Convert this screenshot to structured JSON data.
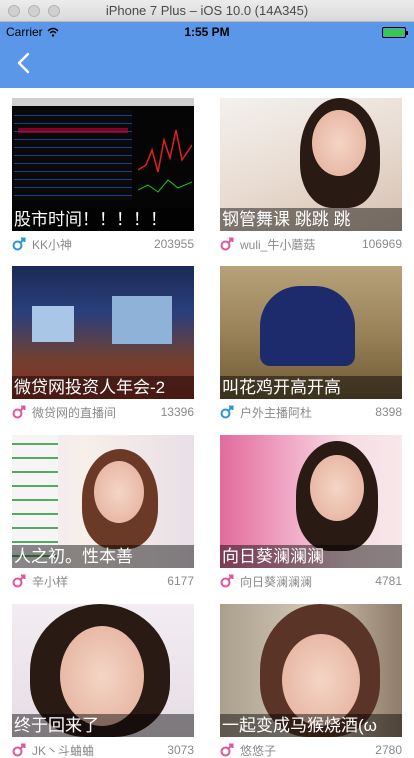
{
  "simulator": {
    "title": "iPhone 7 Plus – iOS 10.0 (14A345)"
  },
  "status_bar": {
    "carrier": "Carrier",
    "time": "1:55 PM"
  },
  "nav": {
    "back_icon": "chevron-left-icon"
  },
  "colors": {
    "nav_bg": "#5b97e8",
    "male_icon_blue": "#2a96d6",
    "male_icon_pink": "#e0559c",
    "battery": "#35c84a"
  },
  "streams": [
    {
      "title": "股市时间！！！！！",
      "anchor": "KK小神",
      "views": "203955",
      "icon_color": "blue"
    },
    {
      "title": "钢管舞课 跳跳 跳",
      "anchor": "wuli_牛小蘑菇",
      "views": "106969",
      "icon_color": "pink"
    },
    {
      "title": "微贷网投资人年会-2",
      "anchor": "微贷网的直播间",
      "views": "13396",
      "icon_color": "pink"
    },
    {
      "title": "叫花鸡开高开高",
      "anchor": "户外主播阿杜",
      "views": "8398",
      "icon_color": "blue"
    },
    {
      "title": "人之初。性本善",
      "anchor": "辛小样",
      "views": "6177",
      "icon_color": "pink"
    },
    {
      "title": "向日葵澜澜澜",
      "anchor": "向日葵澜澜澜",
      "views": "4781",
      "icon_color": "pink"
    },
    {
      "title": "终于回来了",
      "anchor": "JK丶斗蛐蛐",
      "views": "3073",
      "icon_color": "pink"
    },
    {
      "title": "一起变成马猴烧酒(ω",
      "anchor": "悠悠子",
      "views": "2780",
      "icon_color": "pink"
    }
  ]
}
